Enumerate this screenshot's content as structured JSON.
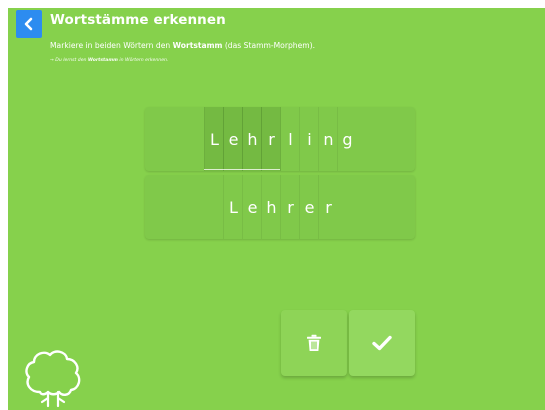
{
  "header": {
    "title": "Wortstämme erkennen",
    "back_icon": "chevron-left-icon"
  },
  "instruction": {
    "prefix": "Markiere in beiden Wörtern den ",
    "bold": "Wortstamm",
    "suffix": " (das Stamm-Morphem)."
  },
  "hint": {
    "prefix": "→ Du lernst den ",
    "bold": "Wortstamm",
    "suffix": " in Wörtern erkennen."
  },
  "words": [
    {
      "letters": [
        "L",
        "e",
        "h",
        "r",
        "l",
        "i",
        "n",
        "g"
      ],
      "stem_selected": [
        true,
        true,
        true,
        true,
        false,
        false,
        false,
        false
      ]
    },
    {
      "letters": [
        "L",
        "e",
        "h",
        "r",
        "e",
        "r"
      ],
      "stem_selected": [
        false,
        false,
        false,
        false,
        false,
        false
      ]
    }
  ],
  "actions": {
    "delete_icon": "trash-icon",
    "confirm_icon": "checkmark-icon"
  },
  "decor": {
    "tree_icon": "tree-icon"
  },
  "colors": {
    "background": "#86d14c",
    "back_button": "#2d8cf0",
    "text": "#ffffff"
  }
}
